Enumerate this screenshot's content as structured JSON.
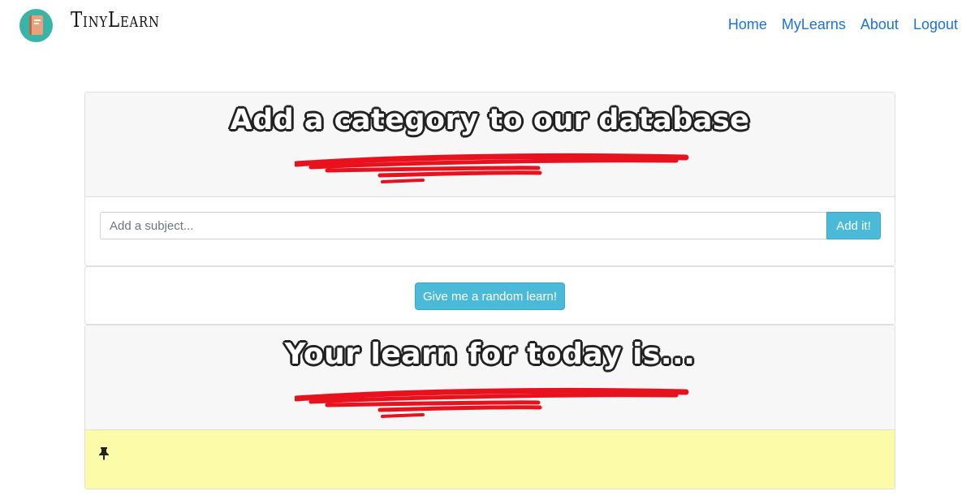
{
  "brand": {
    "name": "TinyLearn"
  },
  "icons": {
    "logo": "book-icon",
    "pin": "pushpin-icon"
  },
  "colors": {
    "accent": "#4bbad9",
    "link": "#1a73d6",
    "underline": "#e8121e",
    "note": "#fcfba7"
  },
  "nav": {
    "items": [
      {
        "label": "Home"
      },
      {
        "label": "MyLearns"
      },
      {
        "label": "About"
      },
      {
        "label": "Logout"
      }
    ]
  },
  "category_panel": {
    "title": "Add a category to our database",
    "input_placeholder": "Add a subject...",
    "input_value": "",
    "submit_label": "Add it!"
  },
  "random_panel": {
    "button_label": "Give me a random learn!"
  },
  "learn_panel": {
    "title": "Your learn for today is...",
    "pin_glyph": "📌"
  }
}
